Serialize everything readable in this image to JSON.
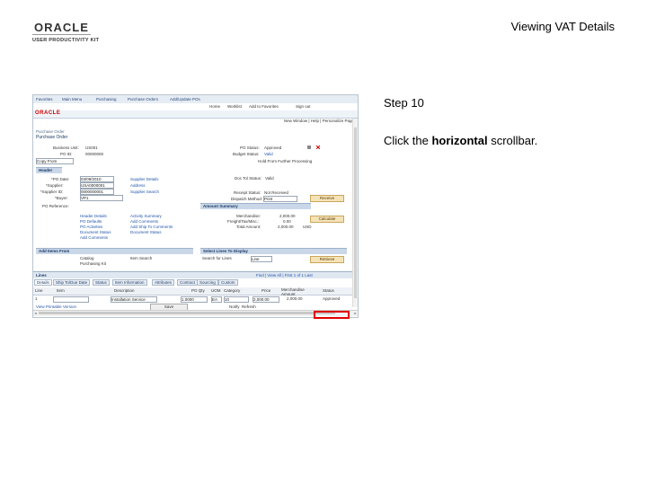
{
  "header": {
    "logo_text": "ORACLE",
    "logo_subtext": "USER PRODUCTIVITY KIT",
    "page_title": "Viewing VAT Details"
  },
  "step": {
    "label": "Step 10",
    "instruction_prefix": "Click the ",
    "instruction_bold": "horizontal",
    "instruction_suffix": " scrollbar."
  },
  "colors": {
    "highlight": "#e00000",
    "brand_red": "#cc0000"
  },
  "screenshot": {
    "topnav": [
      "Favorites",
      "Main Menu",
      "Purchasing",
      "Purchase Orders",
      "Add/Update POs"
    ],
    "menubar": [
      "Home",
      "Worklist",
      "Add to Favorites",
      "Sign out"
    ],
    "oracle_label": "ORACLE",
    "favbar": "New Window | Help | Personalize Page",
    "crumb": "Purchase Order",
    "page_heading": "Purchase Order",
    "fields": {
      "business_unit_lbl": "Business Unit:",
      "business_unit_val": "US001",
      "po_id_lbl": "PO ID:",
      "po_id_val": "00000000",
      "copy_from_lbl": "Copy From",
      "po_status_lbl": "PO Status:",
      "po_status_val": "Approved",
      "budget_status_lbl": "Budget Status:",
      "budget_status_val": "Valid",
      "hold_lbl": "Hold From Further Processing"
    },
    "header_section": "Header",
    "header_fields": {
      "po_date_lbl": "*PO Date:",
      "po_date_val": "03/09/2010",
      "supplier_lbl": "*Supplier:",
      "supplier_val": "USA0000001",
      "supplier_id_lbl": "*Supplier ID:",
      "supplier_id_val": "0000000001",
      "buyer_lbl": "*Buyer:",
      "buyer_val": "VP1",
      "po_reference_lbl": "PO Reference:",
      "supplier_details_link": "Supplier Details",
      "address_link": "Address",
      "supplier_search_link": "Supplier Search",
      "doc_tol_lbl": "Doc Tol Status:",
      "doc_tol_val": "Valid",
      "receipt_status_lbl": "Receipt Status:",
      "receipt_status_val": "Not Received",
      "dispatch_lbl": "Dispatch Method:",
      "dispatch_val": "Print",
      "receive_btn": "Receive"
    },
    "links_left": [
      "Header Details",
      "PO Defaults",
      "PO Activities",
      "Document Status",
      "Add Comments"
    ],
    "links_mid": [
      "Activity Summary",
      "Add Comments",
      "Add Ship To Comments",
      "Document Status"
    ],
    "amount_section": "Amount Summary",
    "amounts": {
      "merchandise_lbl": "Merchandise:",
      "merchandise_val": "2,000.00",
      "freight_lbl": "Freight/Tax/Misc.:",
      "freight_val": "0.00",
      "total_lbl": "Total Amount:",
      "total_val": "2,000.00",
      "currency": "USD",
      "calc_btn": "Calculate"
    },
    "add_items_section": "Add Items From",
    "add_items": {
      "catalog_lbl": "Catalog",
      "item_search_lbl": "Item Search",
      "purchasing_kit_lbl": "Purchasing Kit"
    },
    "select_lines_section": "Select Lines To Display",
    "select_lines": {
      "search_lbl": "Search for Lines",
      "line_val": "Line",
      "retrieve_btn": "Retrieve"
    },
    "grid_title": "Lines",
    "grid_nav": "Find | View All | First 1 of 1 Last",
    "tabs": [
      "Details",
      "Ship To/Due Date",
      "Status",
      "Item Information",
      "Attributes",
      "Contract",
      "Sourcing",
      "Custom"
    ],
    "grid_headers": [
      "Line",
      "Item",
      "Description",
      "PO Qty",
      "UOM",
      "Category",
      "Price",
      "Merchandise Amount",
      "Status"
    ],
    "grid_row": [
      "1",
      "",
      "Installation Service",
      "1.0000",
      "EA",
      "10",
      "2,000.00",
      "2,000.00",
      "Approved"
    ],
    "footer_links": [
      "View Printable Version",
      "Save",
      "Notify",
      "Refresh"
    ]
  }
}
